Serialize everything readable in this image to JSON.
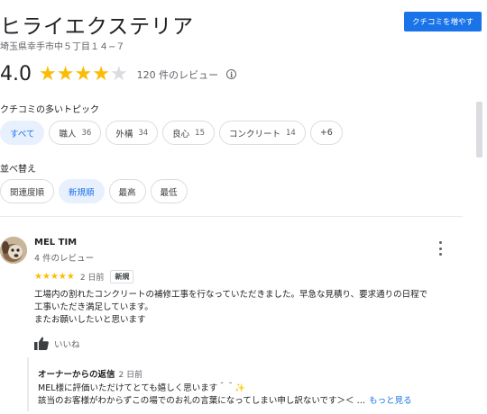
{
  "business": {
    "name": "ヒライエクステリア",
    "address": "埼玉県幸手市中５丁目１４−７",
    "add_review_label": "クチコミを増やす"
  },
  "rating": {
    "value": "4.0",
    "stars_filled": 4,
    "stars_total": 5,
    "review_count_label": "120 件のレビュー",
    "info_icon_glyph": "i"
  },
  "topics": {
    "label": "クチコミの多いトピック",
    "chips": [
      {
        "label": "すべて",
        "count": "",
        "selected": true
      },
      {
        "label": "職人",
        "count": "36",
        "selected": false
      },
      {
        "label": "外構",
        "count": "34",
        "selected": false
      },
      {
        "label": "良心",
        "count": "15",
        "selected": false
      },
      {
        "label": "コンクリート",
        "count": "14",
        "selected": false
      },
      {
        "label": "+6",
        "count": "",
        "selected": false
      }
    ]
  },
  "sort": {
    "label": "並べ替え",
    "chips": [
      {
        "label": "関連度順",
        "selected": false
      },
      {
        "label": "新規順",
        "selected": true
      },
      {
        "label": "最高",
        "selected": false
      },
      {
        "label": "最低",
        "selected": false
      }
    ]
  },
  "review": {
    "reviewer_name": "MEL TIM",
    "reviewer_meta": "4 件のレビュー",
    "stars_filled": 5,
    "date": "2 日前",
    "badge": "新規",
    "body_line1": "工場内の割れたコンクリートの補修工事を行なっていただきました。早急な見積り、要求通りの日程で",
    "body_line2": "工事いただき満足しています。",
    "body_line3": "またお願いしたいと思います",
    "like_label": "いいね",
    "owner_reply": {
      "title": "オーナーからの返信",
      "date": "2 日前",
      "line1": "MEL様に評価いただけてとても嬉しく思います＾＾✨",
      "line2": "該当のお客様がわからずこの場でのお礼の言葉になってしまい申し訳ないです＞＜ …",
      "more_label": "もっと見る"
    }
  },
  "colors": {
    "accent": "#1a73e8",
    "star": "#fbbc04",
    "star_empty": "#dadce0",
    "chip_selected_bg": "#e8f0fe"
  }
}
